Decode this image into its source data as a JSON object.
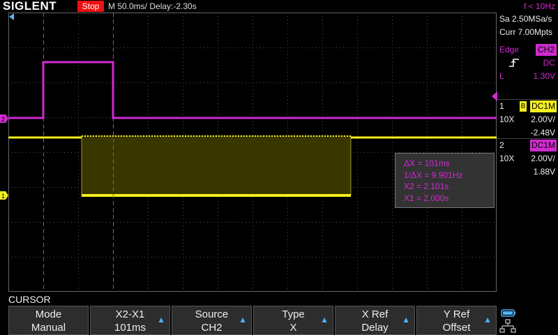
{
  "brand": "SIGLENT",
  "run_state": "Stop",
  "timebase": "M 50.0ms/ Delay:-2.30s",
  "frequency": "f < 10Hz",
  "acquisition": {
    "sample_rate": "Sa 2.50MSa/s",
    "memory": "Curr 7.00Mpts"
  },
  "trigger": {
    "type": "Edge",
    "source": "CH2",
    "coupling": "DC",
    "slope_icon": "rising-edge-icon",
    "level_label": "L",
    "level": "1.30V"
  },
  "channels": [
    {
      "num": "1",
      "bw": "B",
      "coupling": "DC1M",
      "probe": "10X",
      "scale": "2.00V/",
      "offset": "-2.48V",
      "color": "#f2ee20"
    },
    {
      "num": "2",
      "bw": "",
      "coupling": "DC1M",
      "probe": "10X",
      "scale": "2.00V/",
      "offset": "1.88V",
      "color": "#d02ad0"
    }
  ],
  "measurements": {
    "delta_x": "ΔX = 101ms",
    "inv_delta_x": "1/ΔX = 9.901Hz",
    "x2": "X2 = 2.101s",
    "x1": "X1 = 2.000s"
  },
  "menu": {
    "title": "CURSOR",
    "buttons": [
      {
        "label": "Mode",
        "value": "Manual",
        "arrow": false
      },
      {
        "label": "X2-X1",
        "value": "101ms",
        "arrow": true
      },
      {
        "label": "Source",
        "value": "CH2",
        "arrow": true
      },
      {
        "label": "Type",
        "value": "X",
        "arrow": true
      },
      {
        "label": "X Ref",
        "value": "Delay",
        "arrow": true
      },
      {
        "label": "Y Ref",
        "value": "Offset",
        "arrow": true
      }
    ]
  },
  "colors": {
    "ch1": "#f2ee20",
    "ch2": "#d02ad0",
    "grid": "#555555",
    "accent": "#4fb4ff"
  }
}
